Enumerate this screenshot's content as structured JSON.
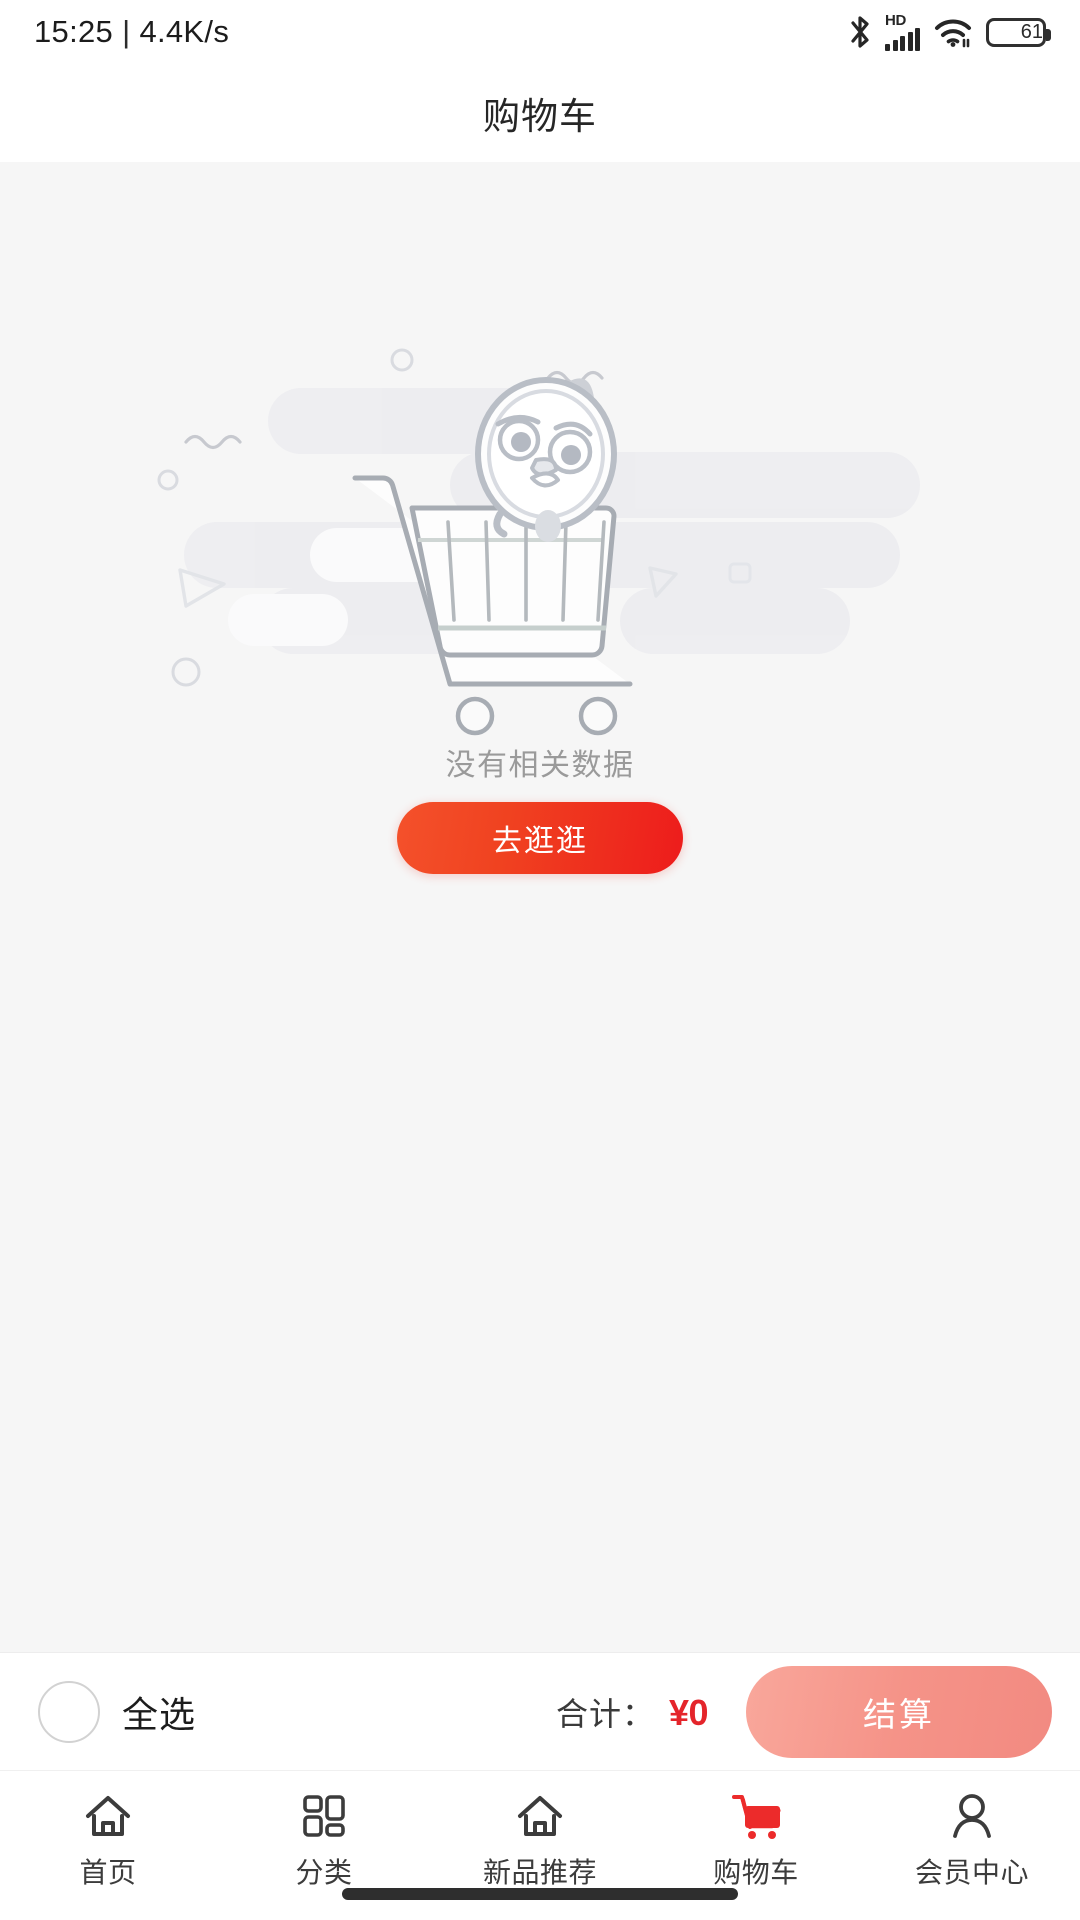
{
  "status_bar": {
    "time": "15:25",
    "separator": "|",
    "network_speed": "4.4K/s",
    "hd_label": "HD",
    "battery_level": "61",
    "icons": [
      "bluetooth-icon",
      "hd-signal-icon",
      "wifi-icon",
      "battery-icon"
    ]
  },
  "header": {
    "title": "购物车"
  },
  "empty_state": {
    "message": "没有相关数据",
    "button_label": "去逛逛",
    "illustration": "empty-cart-bird-illustration"
  },
  "checkout_bar": {
    "select_all_label": "全选",
    "select_all_checked": false,
    "total_label": "合计：",
    "total_amount": "¥0",
    "checkout_label": "结算",
    "checkout_disabled": true
  },
  "tab_bar": {
    "active_index": 3,
    "items": [
      {
        "label": "首页",
        "icon": "home-icon"
      },
      {
        "label": "分类",
        "icon": "grid-icon"
      },
      {
        "label": "新品推荐",
        "icon": "home-outline-icon"
      },
      {
        "label": "购物车",
        "icon": "cart-icon"
      },
      {
        "label": "会员中心",
        "icon": "user-icon"
      }
    ]
  },
  "colors": {
    "accent_red": "#ED1C1C",
    "accent_orange": "#F4512B",
    "price_red": "#E4252B",
    "disabled_pink": "#F59388",
    "page_bg": "#F6F6F6",
    "text_primary": "#1C1C1C",
    "text_muted": "#9A9A9A"
  }
}
